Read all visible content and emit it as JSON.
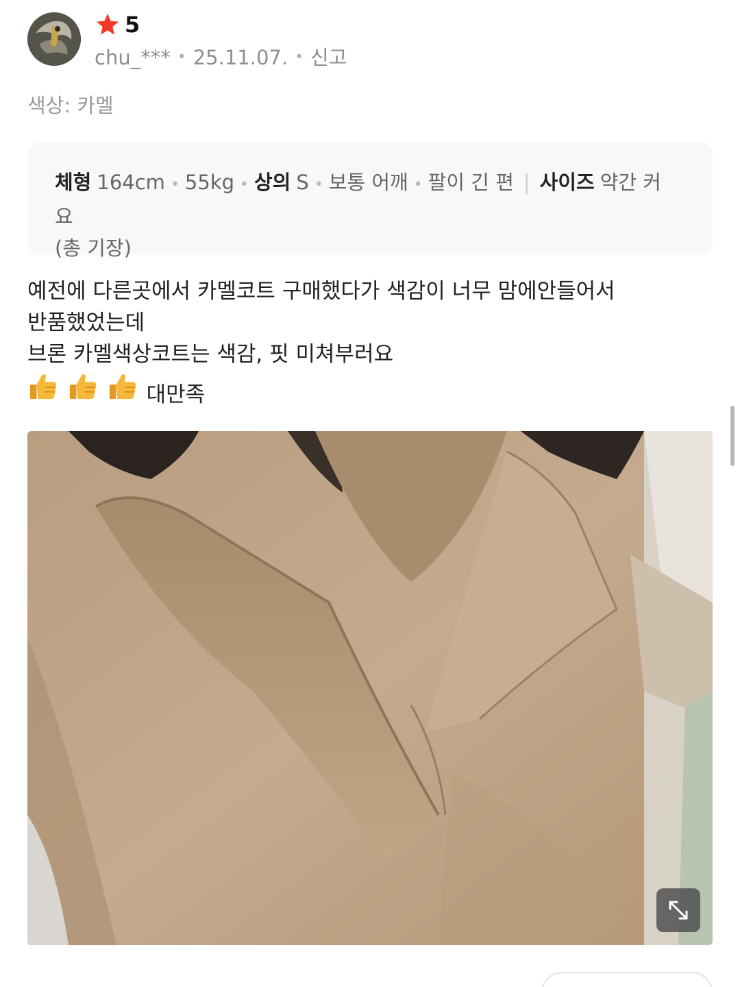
{
  "review": {
    "rating_value": "5",
    "username": "chu_***",
    "date": "25.11.07.",
    "report_label": "신고",
    "option": "색상: 카멜",
    "body_info": {
      "body_label": "체형",
      "height": "164cm",
      "weight": "55kg",
      "top_label": "상의",
      "top_size": "S",
      "shoulder": "보통 어깨",
      "arm": "팔이 긴 편",
      "size_label": "사이즈",
      "size_feedback": "약간 커요",
      "size_detail": "(총 기장)"
    },
    "text_lines": [
      "예전에 다른곳에서 카멜코트 구매했다가 색감이 너무 맘에안들어서",
      "반품했었는데",
      "브론 카멜색상코트는 색감, 핏 미쳐부러요",
      "대만족"
    ],
    "emoji_count": 3
  },
  "colors": {
    "star": "#f23a2a",
    "meta_text": "#8e8e8e",
    "info_box_bg": "#f7f8fa",
    "coat": "#bfa487"
  },
  "icons": {
    "rating": "star-icon",
    "emoji": "thumbs-up-icon",
    "expand": "expand-icon"
  }
}
